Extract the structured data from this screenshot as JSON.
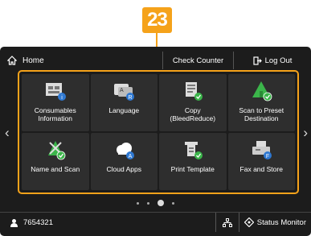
{
  "callout": "23",
  "topbar": {
    "home_label": "Home",
    "check_counter": "Check Counter",
    "log_out": "Log Out"
  },
  "tiles": [
    {
      "label": "Consumables\nInformation",
      "icon": "consumables-icon"
    },
    {
      "label": "Language",
      "icon": "language-icon"
    },
    {
      "label": "Copy\n(BleedReduce)",
      "icon": "copy-icon"
    },
    {
      "label": "Scan to Preset\nDestination",
      "icon": "scan-preset-icon"
    },
    {
      "label": "Name and Scan",
      "icon": "name-scan-icon"
    },
    {
      "label": "Cloud Apps",
      "icon": "cloud-icon"
    },
    {
      "label": "Print Template",
      "icon": "print-template-icon"
    },
    {
      "label": "Fax and Store",
      "icon": "fax-store-icon"
    }
  ],
  "pager": {
    "page": 3,
    "pages": 4
  },
  "bottombar": {
    "user_id": "7654321",
    "status_monitor": "Status Monitor"
  },
  "colors": {
    "accent": "#f5a21a",
    "panel": "#1c1c1c",
    "tile": "#2e2e2e",
    "badge_green": "#3bb54a",
    "badge_blue": "#2e78d2"
  }
}
